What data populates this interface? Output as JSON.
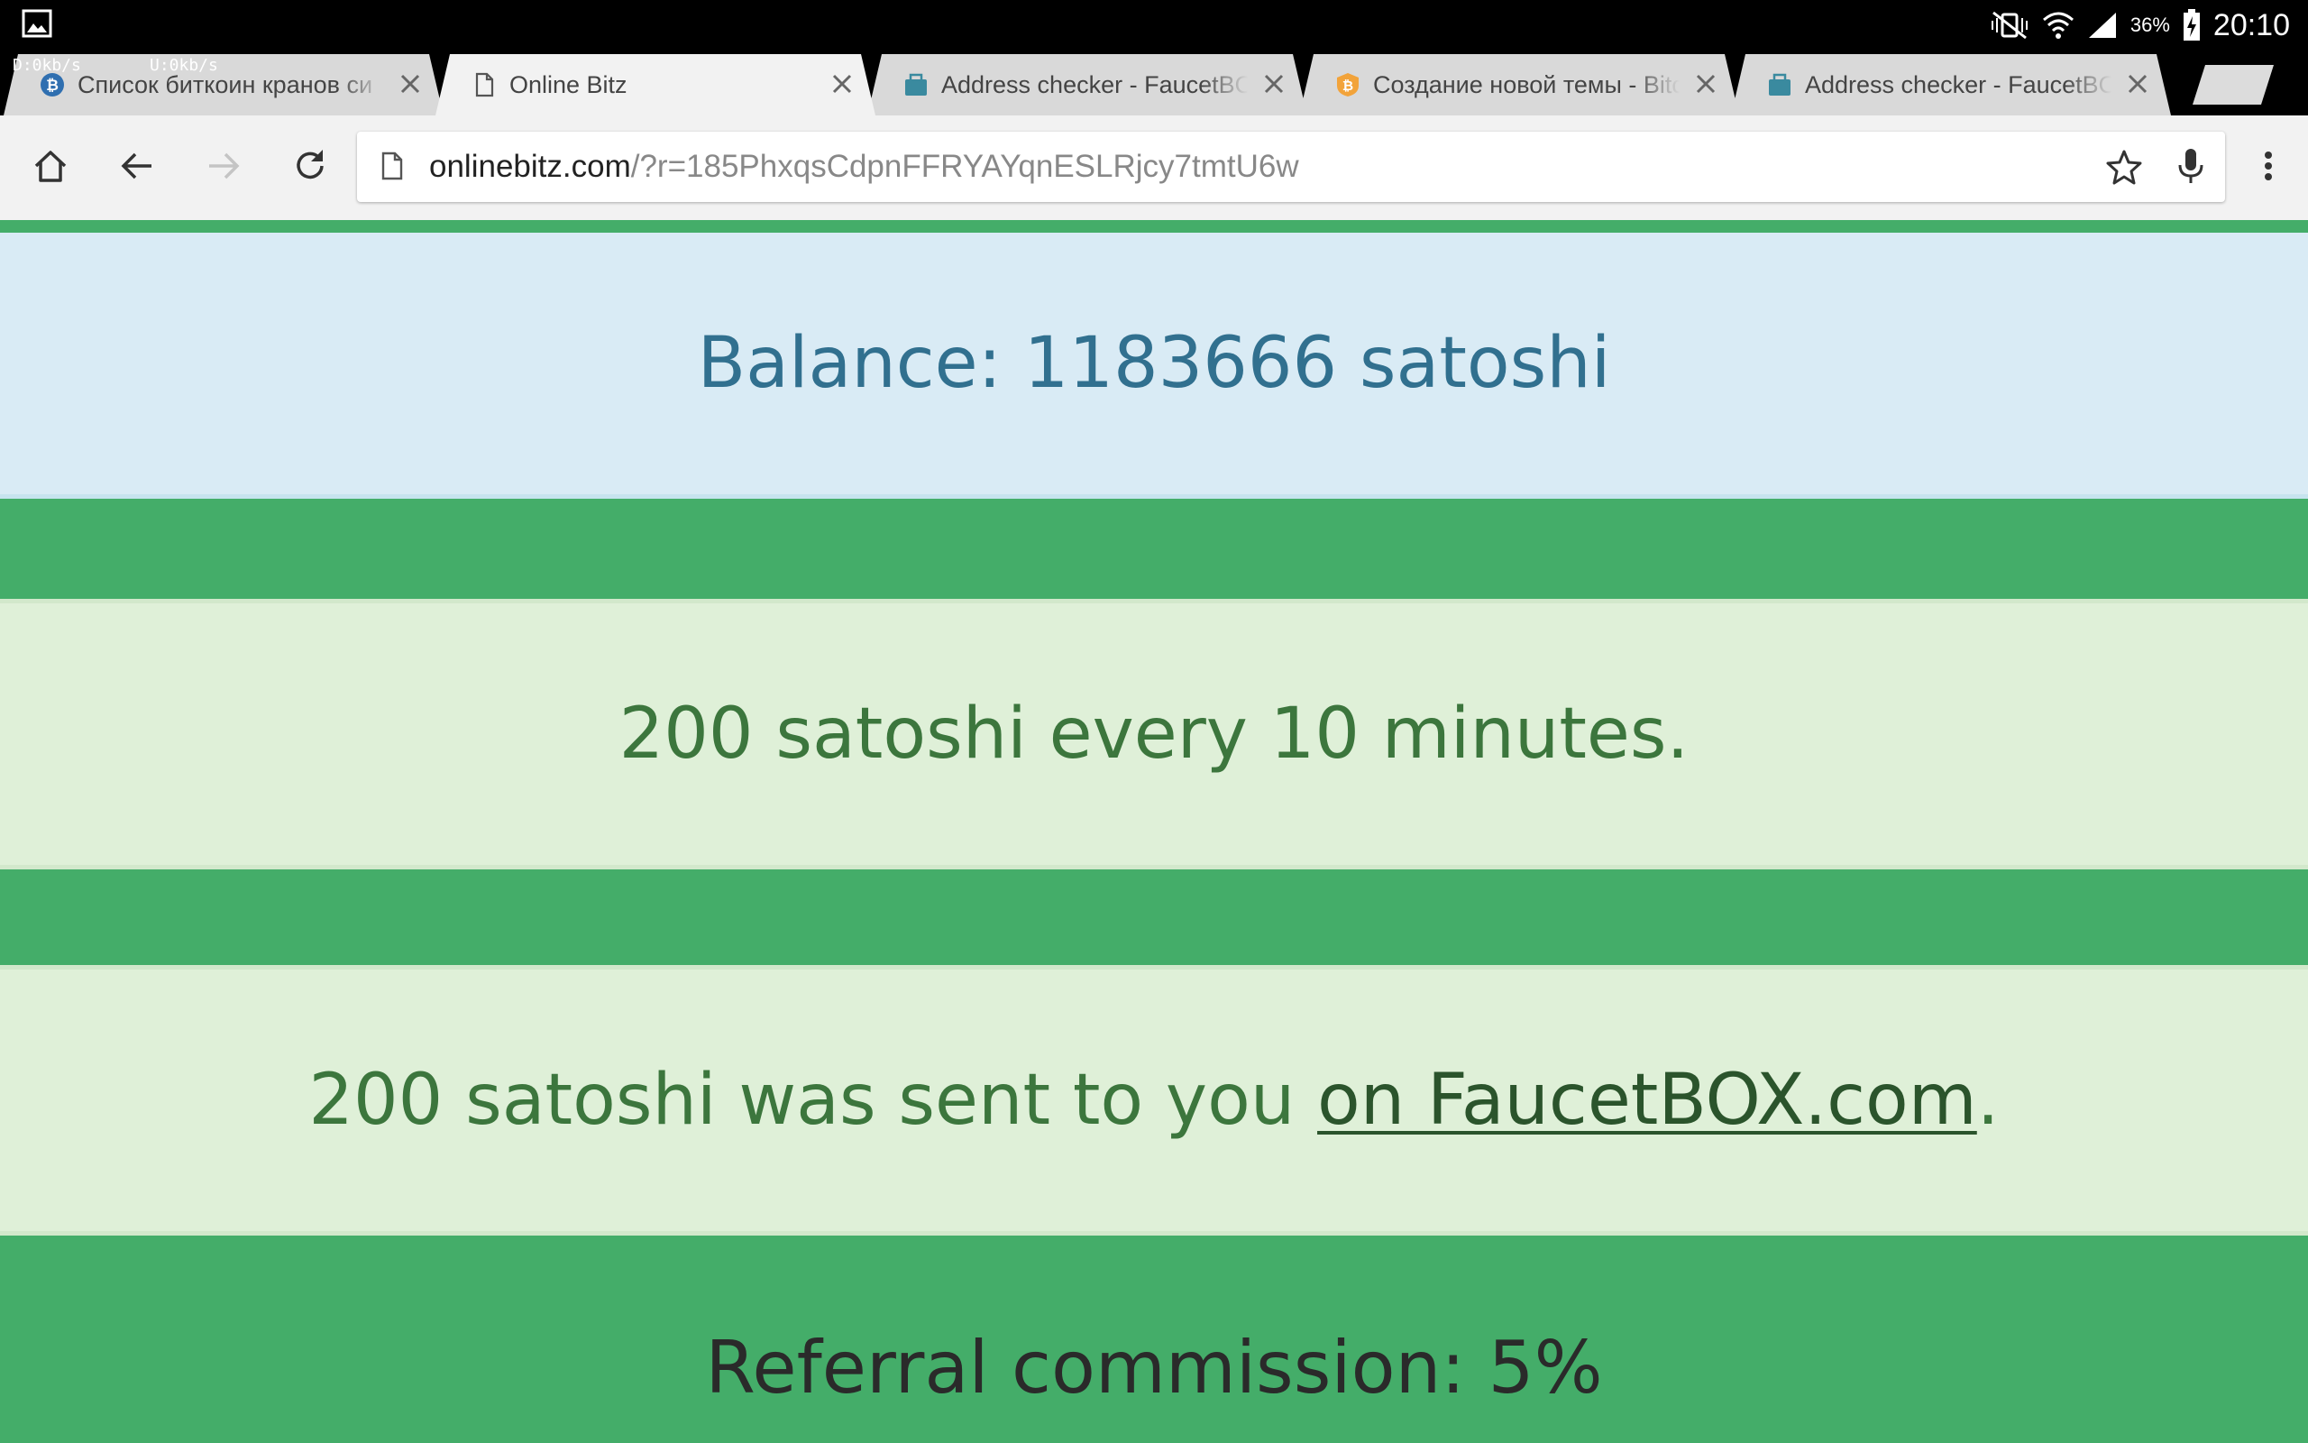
{
  "status_bar": {
    "download_speed": "D:0kb/s",
    "upload_speed": "U:0kb/s",
    "battery": "36%",
    "time": "20:10"
  },
  "tabs": [
    {
      "title": "Список биткоин кранов си",
      "favicon": "bitcoin-blue-icon",
      "active": false
    },
    {
      "title": "Online Bitz",
      "favicon": "page-icon",
      "active": true
    },
    {
      "title": "Address checker - FaucetBOX",
      "favicon": "faucetbox-icon",
      "active": false
    },
    {
      "title": "Создание новой темы - Bitcoin",
      "favicon": "bitcoin-orange-icon",
      "active": false
    },
    {
      "title": "Address checker - FaucetBOX",
      "favicon": "faucetbox-icon",
      "active": false
    }
  ],
  "omnibox": {
    "host": "onlinebitz.com",
    "path": "/?r=185PhxqsCdpnFFRYAYqnESLRjcy7tmtU6w"
  },
  "page": {
    "balance_text": "Balance: 1183666 satoshi",
    "rate_text": "200 satoshi every 10 minutes.",
    "sent_prefix": "200 satoshi was sent to you ",
    "sent_link": "on FaucetBOX.com",
    "sent_suffix": ".",
    "referral_text": "Referral commission: 5%"
  },
  "colors": {
    "page_green": "#44ad69",
    "info_bg": "#d9ebf5",
    "info_text": "#31708f",
    "success_bg": "#dff0d8",
    "success_text": "#3c763d"
  }
}
